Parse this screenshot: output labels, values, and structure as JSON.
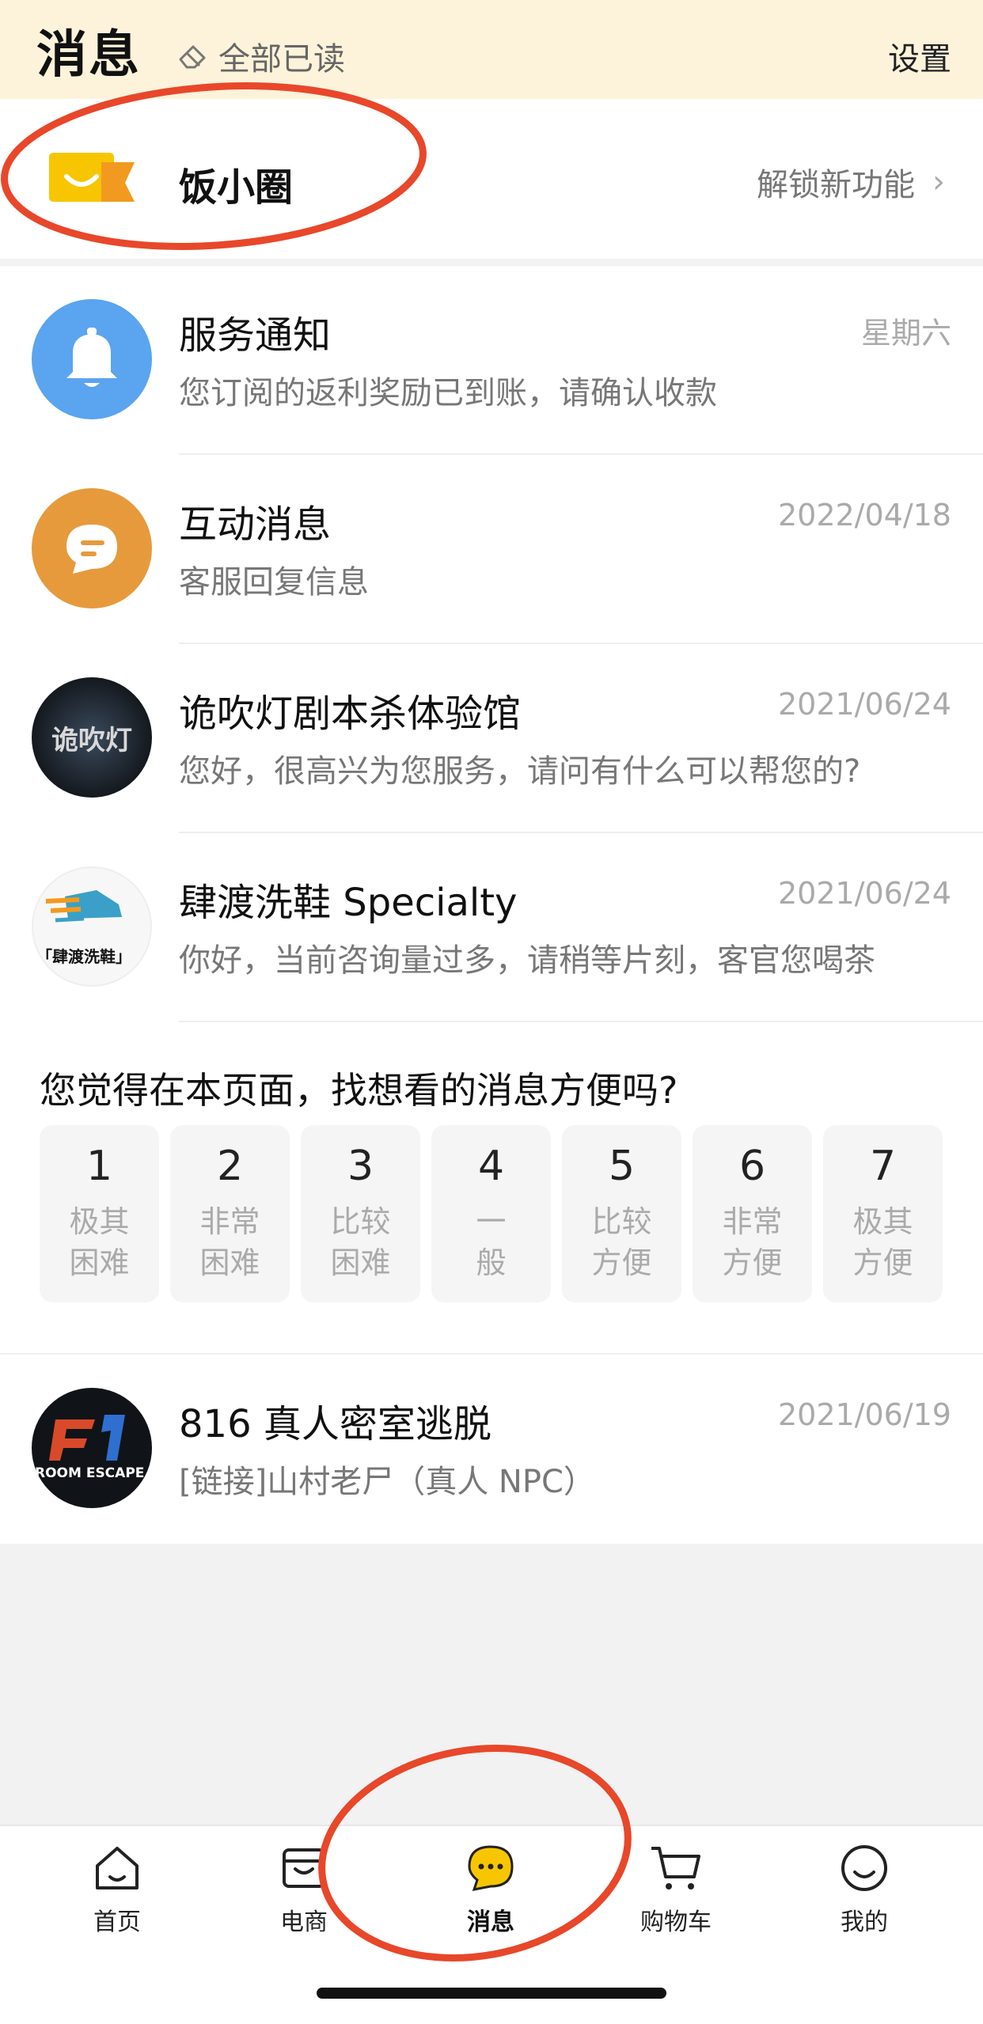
{
  "header": {
    "title": "消息",
    "read_all": "全部已读",
    "settings": "设置"
  },
  "fan_circle": {
    "name": "饭小圈",
    "unlock": "解锁新功能"
  },
  "conversations": [
    {
      "title": "服务通知",
      "time": "星期六",
      "subtitle": "您订阅的返利奖励已到账，请确认收款",
      "avatar": "bell-icon",
      "color": "#5aa4f0"
    },
    {
      "title": "互动消息",
      "time": "2022/04/18",
      "subtitle": "客服回复信息",
      "avatar": "chat-icon",
      "color": "#e69a3c"
    },
    {
      "title": "诡吹灯剧本杀体验馆",
      "time": "2021/06/24",
      "subtitle": "您好，很高兴为您服务，请问有什么可以帮您的?",
      "avatar": "store-avatar",
      "avatar_text": "诡吹灯"
    },
    {
      "title": "肆渡洗鞋 Specialty",
      "time": "2021/06/24",
      "subtitle": "你好，当前咨询量过多，请稍等片刻，客官您喝茶",
      "avatar": "shoe-avatar",
      "avatar_text": "「肆渡洗鞋」"
    },
    {
      "title": "816 真人密室逃脱",
      "time": "2021/06/19",
      "subtitle": "[链接]山村老尸（真人 NPC）",
      "avatar": "escape-avatar",
      "avatar_text": "ROOM ESCAPE"
    }
  ],
  "survey": {
    "question": "您觉得在本页面，找想看的消息方便吗?",
    "options": [
      {
        "num": "1",
        "label": "极其\n困难"
      },
      {
        "num": "2",
        "label": "非常\n困难"
      },
      {
        "num": "3",
        "label": "比较\n困难"
      },
      {
        "num": "4",
        "label": "一\n般"
      },
      {
        "num": "5",
        "label": "比较\n方便"
      },
      {
        "num": "6",
        "label": "非常\n方便"
      },
      {
        "num": "7",
        "label": "极其\n方便"
      }
    ]
  },
  "tabs": [
    {
      "label": "首页",
      "icon": "home-icon"
    },
    {
      "label": "电商",
      "icon": "shop-icon"
    },
    {
      "label": "消息",
      "icon": "message-icon",
      "active": true
    },
    {
      "label": "购物车",
      "icon": "cart-icon"
    },
    {
      "label": "我的",
      "icon": "smile-icon"
    }
  ],
  "colors": {
    "accent": "#f7c600",
    "annotation": "#e8472a",
    "header_bg": "#fdf3da"
  }
}
